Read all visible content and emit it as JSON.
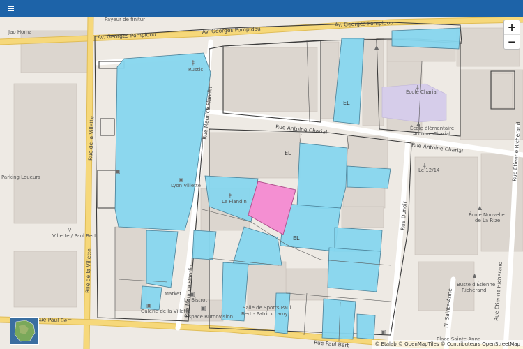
{
  "header": {
    "menu_icon": "hamburger-icon"
  },
  "map": {
    "labels": {
      "payeur": "Payeur de finitur",
      "costa": "Jao Homa",
      "parking": "Parking Loueurs",
      "villette_paul_bert": "Villette / Paul Bert",
      "rustic": "Rustic",
      "lyon_villette": "Lyon Villette",
      "le_flandin": "Le Flandin",
      "ecole_charial": "École Charial",
      "ecole_elementaire": "École élémentaire",
      "antoine_charial": "Antoine Charial",
      "le_12_14": "Le 12/14",
      "ecole_nouvelle": "École Nouvelle",
      "de_la_rize": "de La Rize",
      "market": "Market",
      "bistrot": "Le Bistrot",
      "galerie": "Galerie de la Villette",
      "espace": "Espace Buroovision",
      "salle_sports_1": "Salle de Sports Paul",
      "salle_sports_2": "Bert - Patrick Lamy",
      "buste_1": "Buste d'Étienne",
      "buste_2": "Richerand",
      "place": "Place Sainte-Anne",
      "el_1": "EL",
      "el_2": "EL",
      "el_3": "EL"
    },
    "roads": {
      "georges_pompidou_1": "Av. Georges Pompidou",
      "georges_pompidou_2": "Av. Georges Pompidou",
      "georges_pompidou_3": "Av. Georges Pompidou",
      "antoine_charial_1": "Rue Antoine Charial",
      "antoine_charial_2": "Rue Antoine Charial",
      "maurice_flandin_1": "Rue Maurice Flandin",
      "maurice_flandin_2": "Rue Maurice Flandin",
      "la_villette_1": "Rue de la Villette",
      "la_villette_2": "Rue de la Villette",
      "paul_bert_1": "Rue Paul Bert",
      "paul_bert_2": "Rue Paul Bert",
      "etienne_richerand_1": "Rue Étienne Richerand",
      "etienne_richerand_2": "Rue Étienne Richerand",
      "sainte_anne": "Pl. Sainte-Anne",
      "dunoir": "Rue Dunoir"
    },
    "colors": {
      "background": "#eeeae4",
      "building": "#dcd6cf",
      "parcel_highlight": "#86d6ee",
      "parcel_selected": "#f48fd2",
      "road_major": "#f6d87a",
      "road_minor": "#ffffff",
      "school": "#d6cdea",
      "header": "#1d63a8"
    }
  },
  "controls": {
    "zoom_in": "+",
    "zoom_out": "−"
  },
  "attribution": "© Etalab © OpenMapTiles © Contributeurs OpenStreetMap"
}
